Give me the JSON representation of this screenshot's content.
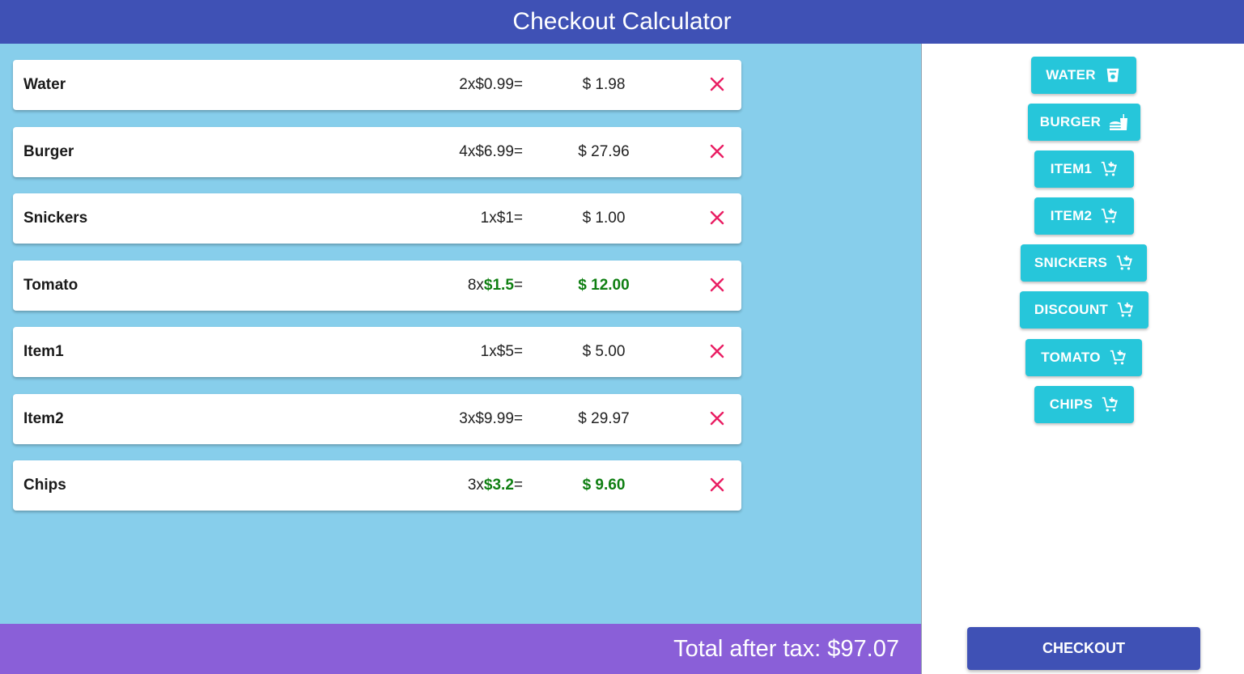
{
  "header": {
    "title": "Checkout Calculator"
  },
  "cart": {
    "items": [
      {
        "name": "Water",
        "qty": "2",
        "price": "$0.99",
        "total": "$ 1.98",
        "discounted": false
      },
      {
        "name": "Burger",
        "qty": "4",
        "price": "$6.99",
        "total": "$ 27.96",
        "discounted": false
      },
      {
        "name": "Snickers",
        "qty": "1",
        "price": "$1",
        "total": "$ 1.00",
        "discounted": false
      },
      {
        "name": "Tomato",
        "qty": "8",
        "price": "$1.5",
        "total": "$ 12.00",
        "discounted": true
      },
      {
        "name": "Item1",
        "qty": "1",
        "price": "$5",
        "total": "$ 5.00",
        "discounted": false
      },
      {
        "name": "Item2",
        "qty": "3",
        "price": "$9.99",
        "total": "$ 29.97",
        "discounted": false
      },
      {
        "name": "Chips",
        "qty": "3",
        "price": "$3.2",
        "total": "$ 9.60",
        "discounted": true
      }
    ],
    "times_symbol": "x",
    "equals_symbol": "=",
    "remove_icon": "close-icon"
  },
  "total": {
    "text": "Total after tax: $97.07"
  },
  "products": [
    {
      "label": "WATER",
      "icon": "cup-icon"
    },
    {
      "label": "BURGER",
      "icon": "fastfood-icon"
    },
    {
      "label": "ITEM1",
      "icon": "add-cart-icon"
    },
    {
      "label": "ITEM2",
      "icon": "add-cart-icon"
    },
    {
      "label": "SNICKERS",
      "icon": "add-cart-icon"
    },
    {
      "label": "DISCOUNT",
      "icon": "add-cart-icon"
    },
    {
      "label": "TOMATO",
      "icon": "add-cart-icon"
    },
    {
      "label": "CHIPS",
      "icon": "add-cart-icon"
    }
  ],
  "checkout": {
    "label": "CHECKOUT"
  },
  "colors": {
    "header": "#3f51b5",
    "cart_background": "#87ceeb",
    "total_bar": "#8a5fd8",
    "product_button": "#26c6da",
    "checkout_button": "#3f51b5",
    "remove_icon": "#e91e63",
    "discount_text": "#0f7f12"
  }
}
